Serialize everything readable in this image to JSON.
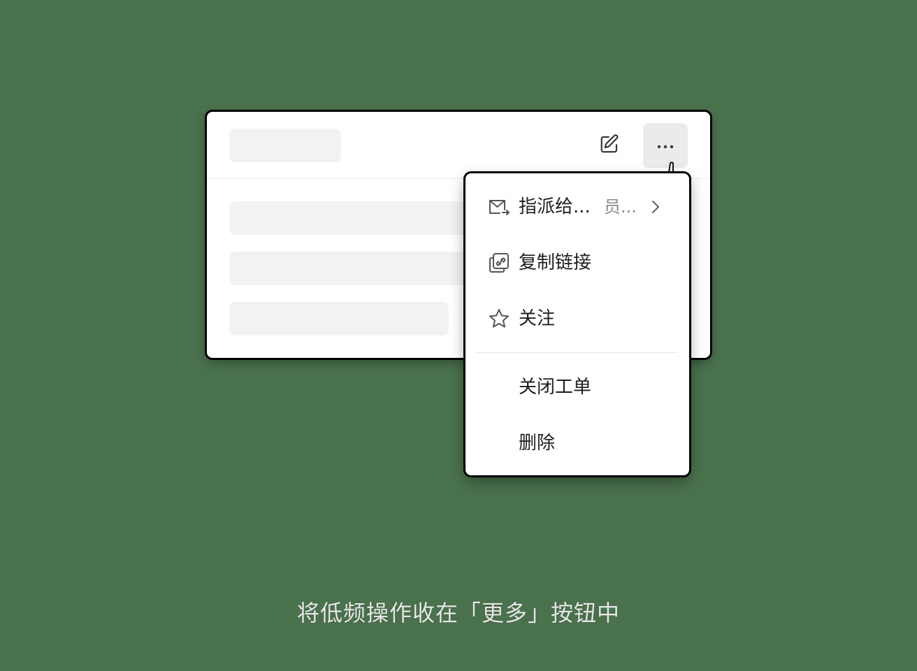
{
  "toolbar": {
    "edit_icon": "edit-icon",
    "more_icon": "ellipsis-icon",
    "cursor_icon": "hand-pointer-icon"
  },
  "menu": {
    "items": [
      {
        "label": "指派给...",
        "sub": "员...",
        "icon": "mail-forward-icon",
        "has_submenu": true
      },
      {
        "label": "复制链接",
        "icon": "copy-link-icon"
      },
      {
        "label": "关注",
        "icon": "star-icon"
      },
      {
        "label": "关闭工单"
      },
      {
        "label": "删除"
      }
    ]
  },
  "caption": "将低频操作收在「更多」按钮中",
  "colors": {
    "background": "#4a724d",
    "card": "#ffffff",
    "skeleton": "#f2f2f2",
    "more_button_bg": "#ebebeb",
    "text": "#1f1f1f",
    "subtext": "#8a8a8a"
  }
}
